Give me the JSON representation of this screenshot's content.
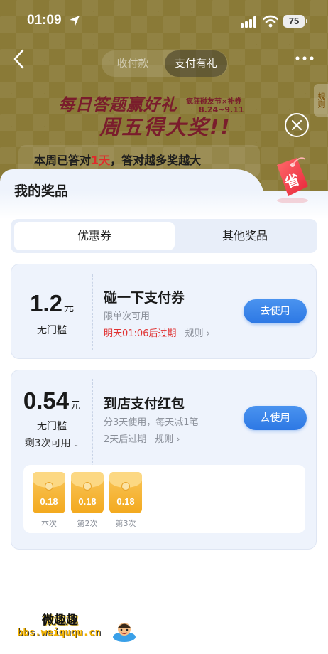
{
  "status": {
    "time": "01:09",
    "battery": "75"
  },
  "nav": {
    "tabs": [
      "收付款",
      "支付有礼"
    ],
    "active_tab": "支付有礼"
  },
  "banner": {
    "title_line1": "每日答题赢好礼",
    "title_line2": "周五得大奖!!",
    "badge": "疯狂碰友节×补券",
    "date": "8.24~9.11",
    "side_tab": "规则",
    "quiz_prefix": "本周已答对",
    "quiz_days": "1天",
    "quiz_suffix": "，答对越多奖越大"
  },
  "sheet": {
    "title": "我的奖品",
    "tag_char": "省",
    "tabs": [
      "优惠券",
      "其他奖品"
    ],
    "active_tab": "优惠券"
  },
  "coupons": [
    {
      "amount": "1.2",
      "unit": "元",
      "condition": "无门槛",
      "title": "碰一下支付券",
      "sub": "限单次可用",
      "expire": "明天01:06后过期",
      "rule": "规则",
      "button": "去使用"
    },
    {
      "amount": "0.54",
      "unit": "元",
      "condition": "无门槛",
      "remain": "剩3次可用",
      "title": "到店支付红包",
      "sub": "分3天使用，每天减1笔",
      "expire": "2天后过期",
      "rule": "规则",
      "button": "去使用",
      "envelopes": [
        {
          "value": "0.18",
          "label": "本次"
        },
        {
          "value": "0.18",
          "label": "第2次"
        },
        {
          "value": "0.18",
          "label": "第3次"
        }
      ]
    }
  ],
  "watermark": {
    "top": "微趣趣",
    "url": "bbs.weiququ.cn"
  },
  "colors": {
    "accent": "#2d78e4",
    "expire_red": "#e03232",
    "card_bg": "#eef3fc",
    "envelope": "#f3a91e"
  }
}
